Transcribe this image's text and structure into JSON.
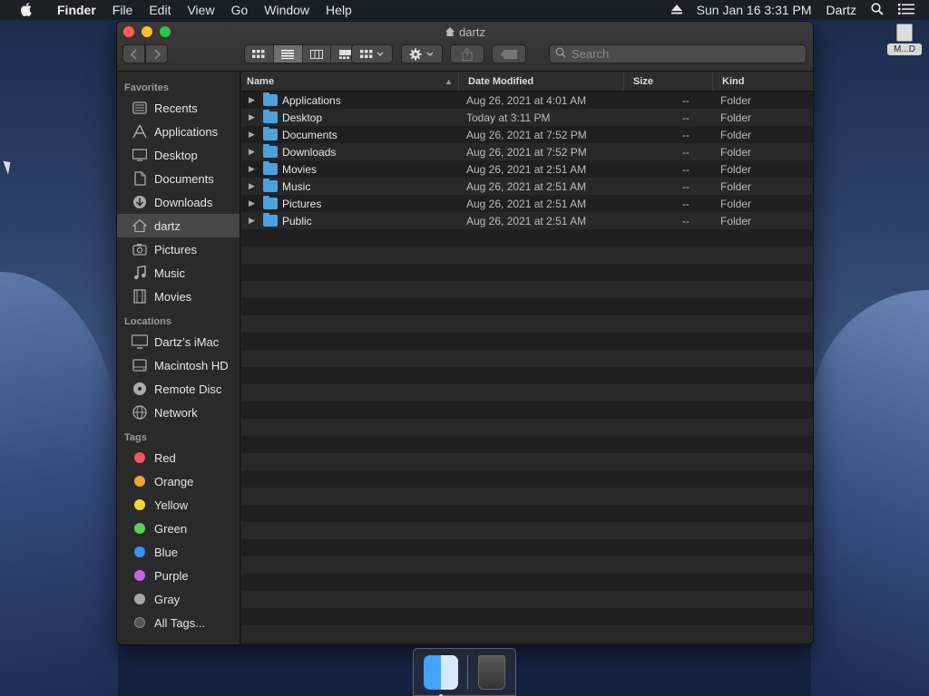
{
  "menubar": {
    "app_name": "Finder",
    "items": [
      "File",
      "Edit",
      "View",
      "Go",
      "Window",
      "Help"
    ],
    "datetime": "Sun Jan 16  3:31 PM",
    "user": "Dartz"
  },
  "desktop": {
    "icon_label": "M...D"
  },
  "window": {
    "title": "dartz",
    "search_placeholder": "Search",
    "sidebar": {
      "favorites_label": "Favorites",
      "favorites": [
        {
          "label": "Recents",
          "icon": "recents-icon"
        },
        {
          "label": "Applications",
          "icon": "applications-icon"
        },
        {
          "label": "Desktop",
          "icon": "desktop-icon"
        },
        {
          "label": "Documents",
          "icon": "documents-icon"
        },
        {
          "label": "Downloads",
          "icon": "downloads-icon"
        },
        {
          "label": "dartz",
          "icon": "home-icon",
          "selected": true
        },
        {
          "label": "Pictures",
          "icon": "pictures-icon"
        },
        {
          "label": "Music",
          "icon": "music-icon"
        },
        {
          "label": "Movies",
          "icon": "movies-icon"
        }
      ],
      "locations_label": "Locations",
      "locations": [
        {
          "label": "Dartz’s iMac",
          "icon": "imac-icon"
        },
        {
          "label": "Macintosh HD",
          "icon": "disk-icon"
        },
        {
          "label": "Remote Disc",
          "icon": "disc-icon"
        },
        {
          "label": "Network",
          "icon": "network-icon"
        }
      ],
      "tags_label": "Tags",
      "tags": [
        {
          "label": "Red",
          "color": "#f0585b"
        },
        {
          "label": "Orange",
          "color": "#f6a331"
        },
        {
          "label": "Yellow",
          "color": "#f5d63a"
        },
        {
          "label": "Green",
          "color": "#5ad15a"
        },
        {
          "label": "Blue",
          "color": "#3d8ff5"
        },
        {
          "label": "Purple",
          "color": "#c167e0"
        },
        {
          "label": "Gray",
          "color": "#a8a8a8"
        },
        {
          "label": "All Tags...",
          "color": "#555555"
        }
      ]
    },
    "columns": {
      "name": "Name",
      "date": "Date Modified",
      "size": "Size",
      "kind": "Kind"
    },
    "rows": [
      {
        "name": "Applications",
        "date": "Aug 26, 2021 at 4:01 AM",
        "size": "--",
        "kind": "Folder"
      },
      {
        "name": "Desktop",
        "date": "Today at 3:11 PM",
        "size": "--",
        "kind": "Folder"
      },
      {
        "name": "Documents",
        "date": "Aug 26, 2021 at 7:52 PM",
        "size": "--",
        "kind": "Folder"
      },
      {
        "name": "Downloads",
        "date": "Aug 26, 2021 at 7:52 PM",
        "size": "--",
        "kind": "Folder"
      },
      {
        "name": "Movies",
        "date": "Aug 26, 2021 at 2:51 AM",
        "size": "--",
        "kind": "Folder"
      },
      {
        "name": "Music",
        "date": "Aug 26, 2021 at 2:51 AM",
        "size": "--",
        "kind": "Folder"
      },
      {
        "name": "Pictures",
        "date": "Aug 26, 2021 at 2:51 AM",
        "size": "--",
        "kind": "Folder"
      },
      {
        "name": "Public",
        "date": "Aug 26, 2021 at 2:51 AM",
        "size": "--",
        "kind": "Folder"
      }
    ],
    "empty_row_count": 24
  }
}
